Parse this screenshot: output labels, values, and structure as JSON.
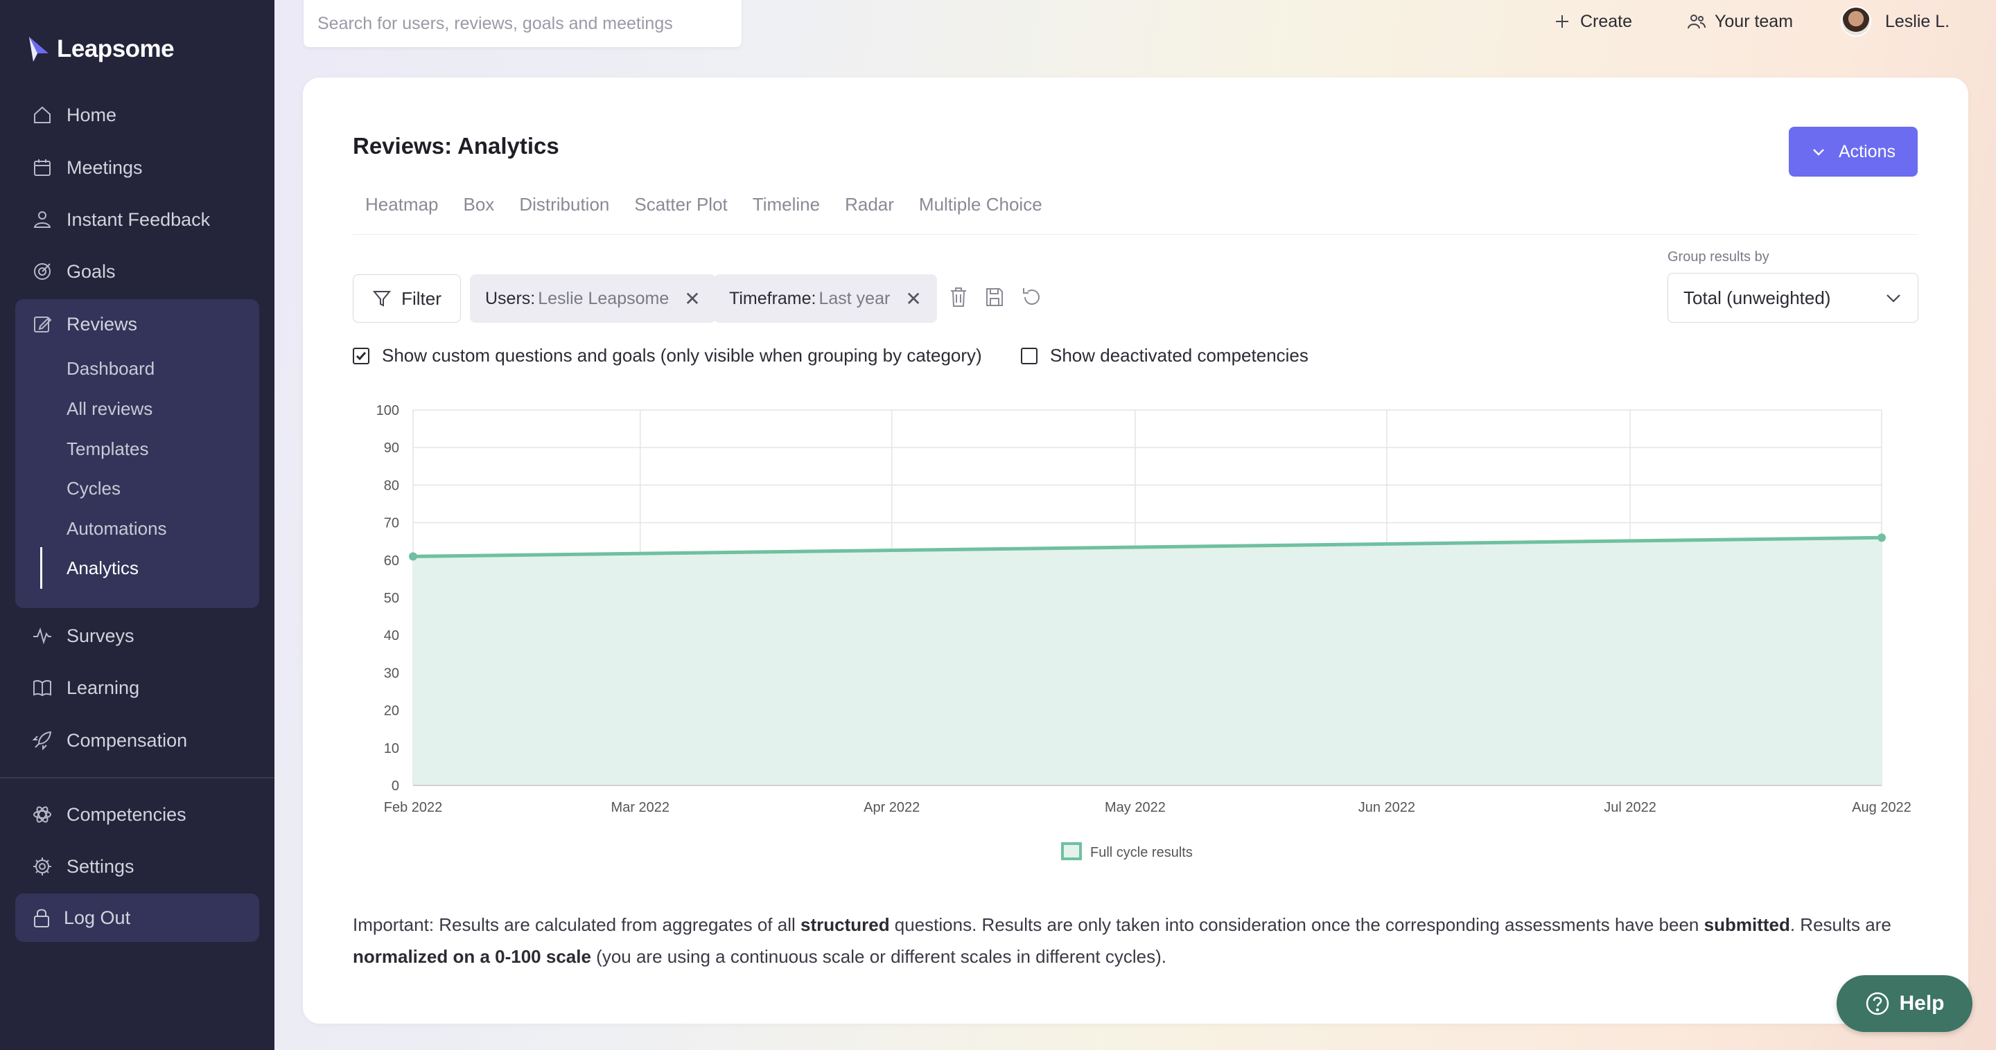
{
  "sidebar": {
    "logo": "Leapsome",
    "items": [
      {
        "label": "Home",
        "icon": "home-icon"
      },
      {
        "label": "Meetings",
        "icon": "calendar-icon"
      },
      {
        "label": "Instant Feedback",
        "icon": "feedback-icon"
      },
      {
        "label": "Goals",
        "icon": "target-icon"
      },
      {
        "label": "Reviews",
        "icon": "edit-icon"
      },
      {
        "label": "Surveys",
        "icon": "pulse-icon"
      },
      {
        "label": "Learning",
        "icon": "book-icon"
      },
      {
        "label": "Compensation",
        "icon": "rocket-icon"
      },
      {
        "label": "Competencies",
        "icon": "atom-icon"
      },
      {
        "label": "Settings",
        "icon": "gear-icon"
      }
    ],
    "reviews_sub": [
      "Dashboard",
      "All reviews",
      "Templates",
      "Cycles",
      "Automations",
      "Analytics"
    ],
    "active_sub": "Analytics",
    "logout": "Log Out"
  },
  "topbar": {
    "search_placeholder": "Search for users, reviews, goals and meetings",
    "create": "Create",
    "your_team": "Your team",
    "user": "Leslie L."
  },
  "main": {
    "title": "Reviews: Analytics",
    "actions": "Actions",
    "tabs": [
      "Heatmap",
      "Box",
      "Distribution",
      "Scatter Plot",
      "Timeline",
      "Radar",
      "Multiple Choice"
    ],
    "filter": "Filter",
    "chips": [
      {
        "key": "Users:",
        "value": "Leslie Leapsome"
      },
      {
        "key": "Timeframe:",
        "value": "Last year"
      }
    ],
    "group_label": "Group results by",
    "group_value": "Total (unweighted)",
    "checkbox_custom": "Show custom questions and goals (only visible when grouping by category)",
    "checkbox_custom_checked": true,
    "checkbox_deactivated": "Show deactivated competencies",
    "checkbox_deactivated_checked": false,
    "note": {
      "p1": "Important: Results are calculated from aggregates of all ",
      "b1": "structured",
      "p2": " questions. Results are only taken into consideration once the corresponding assessments have been ",
      "b2": "submitted",
      "p3": ". Results are ",
      "b3": "normalized on a 0-100 scale",
      "p4": " (you are using a continuous scale or different scales in different cycles)."
    },
    "help": "Help"
  },
  "chart_data": {
    "type": "area",
    "x": [
      "Feb 2022",
      "Mar 2022",
      "Apr 2022",
      "May 2022",
      "Jun 2022",
      "Jul 2022",
      "Aug 2022"
    ],
    "x_days_offsets_note_removed": null,
    "series": [
      {
        "name": "Full cycle results",
        "points": [
          {
            "x": "2022-02-01",
            "y": 61
          },
          {
            "x": "2022-08-01",
            "y": 66
          }
        ]
      }
    ],
    "ylim": [
      0,
      100
    ],
    "yticks": [
      0,
      10,
      20,
      30,
      40,
      50,
      60,
      70,
      80,
      90,
      100
    ],
    "grid": true,
    "legend": "bottom-center",
    "colors": {
      "line": "#6fc0a0",
      "fill": "#e3f2ec"
    }
  }
}
